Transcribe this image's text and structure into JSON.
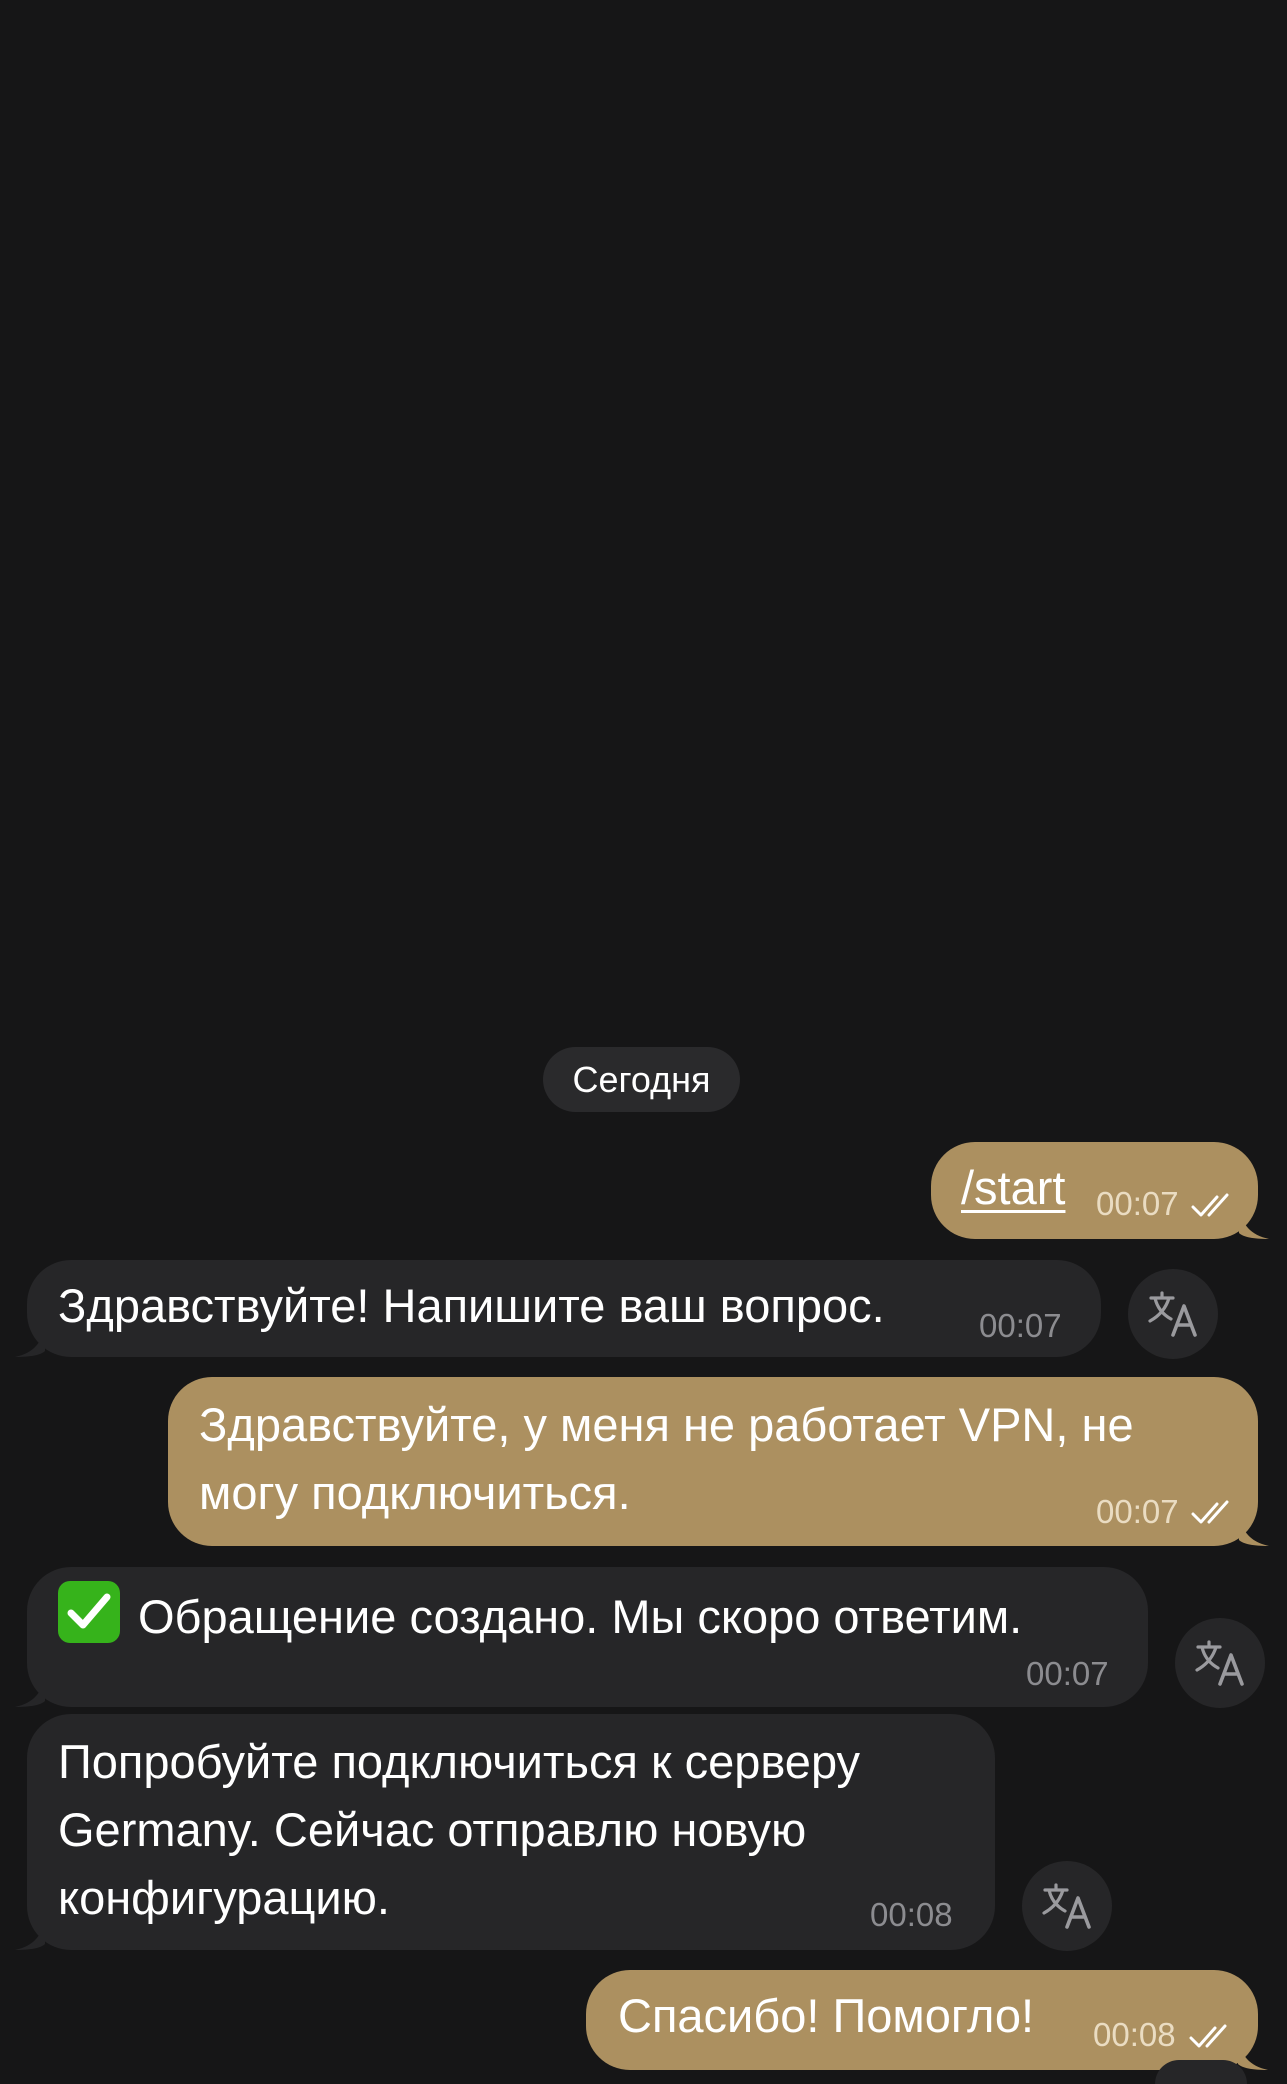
{
  "chat": {
    "date_separator": "Сегодня",
    "messages": [
      {
        "direction": "outgoing",
        "text": "/start",
        "time": "00:07"
      },
      {
        "direction": "incoming",
        "text": "Здравствуйте! Напишите ваш вопрос.",
        "time": "00:07"
      },
      {
        "direction": "outgoing",
        "text": "Здравствуйте, у меня не работает VPN, не\nмогу подключиться.",
        "time": "00:07"
      },
      {
        "direction": "incoming",
        "text": "Обращение создано. Мы скоро ответим.",
        "time": "00:07"
      },
      {
        "direction": "incoming",
        "text": "Попробуйте подключиться к серверу\nGermany. Сейчас отправлю новую\nконфигурацию.",
        "time": "00:08"
      },
      {
        "direction": "outgoing",
        "text": "Спасибо! Помогло!",
        "time": "00:08"
      }
    ]
  },
  "icons": {
    "read_receipt": "double-check-icon",
    "translate": "translate-icon",
    "status_emoji": "check-mark-button-emoji"
  },
  "colors": {
    "background": "#161617",
    "outgoing_bubble": "#ac9060",
    "incoming_bubble": "#262628",
    "date_pill": "#2a2a2c"
  }
}
